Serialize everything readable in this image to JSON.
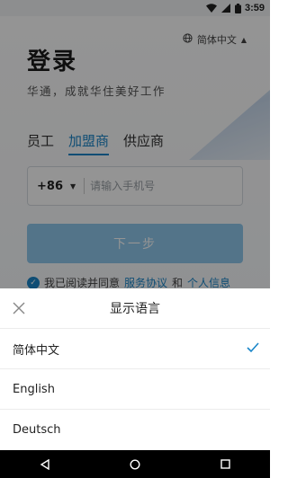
{
  "status_bar": {
    "time": "3:59",
    "icons": [
      "wifi-icon",
      "signal-icon",
      "battery-icon"
    ]
  },
  "login": {
    "language_switch": "简体中文",
    "title": "登录",
    "slogan": "华通，成就华住美好工作",
    "tabs": [
      "员工",
      "加盟商",
      "供应商"
    ],
    "active_tab": "加盟商",
    "country_code": "+86",
    "phone_placeholder": "请输入手机号",
    "next_button": "下一步",
    "agreement": {
      "prefix": "我已阅读并同意",
      "service_link": "服务协议",
      "connector": "和",
      "privacy_link": "个人信息"
    }
  },
  "language_sheet": {
    "title": "显示语言",
    "options": [
      "简体中文",
      "English",
      "Deutsch"
    ],
    "selected": "简体中文"
  },
  "colors": {
    "accent": "#1a86c9",
    "button_disabled": "#8fc8ec"
  }
}
